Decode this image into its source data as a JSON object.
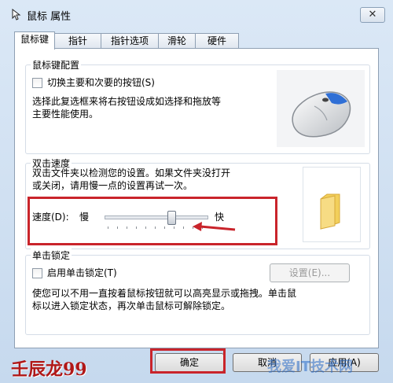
{
  "window": {
    "title": "鼠标 属性",
    "close_label": "✕"
  },
  "tabs": [
    {
      "label": "鼠标键",
      "active": true
    },
    {
      "label": "指针",
      "active": false
    },
    {
      "label": "指针选项",
      "active": false
    },
    {
      "label": "滑轮",
      "active": false
    },
    {
      "label": "硬件",
      "active": false
    }
  ],
  "button_config": {
    "title": "鼠标键配置",
    "checkbox_label": "切换主要和次要的按钮(S)",
    "checked": false,
    "description_line1": "选择此复选框来将右按钮设成如选择和拖放等",
    "description_line2": "主要性能使用。"
  },
  "double_click": {
    "title": "双击速度",
    "description_line1": "双击文件夹以检测您的设置。如果文件夹没打开",
    "description_line2": "或关闭，请用慢一点的设置再试一次。",
    "speed_label": "速度(D):",
    "slow_label": "慢",
    "fast_label": "快",
    "slider_value_fraction": 0.67
  },
  "click_lock": {
    "title": "单击锁定",
    "checkbox_label": "启用单击锁定(T)",
    "checked": false,
    "settings_button": "设置(E)...",
    "description_line1": "使您可以不用一直按着鼠标按钮就可以高亮显示或拖拽。单击鼠",
    "description_line2": "标以进入锁定状态，再次单击鼠标可解除锁定。"
  },
  "footer": {
    "ok": "确定",
    "cancel": "取消",
    "apply": "应用(A)"
  },
  "watermark": {
    "author": "壬辰龙99",
    "site": "我爱IT技术网"
  },
  "colors": {
    "highlight": "#c9242b",
    "window_bg": "#cfdff0"
  }
}
